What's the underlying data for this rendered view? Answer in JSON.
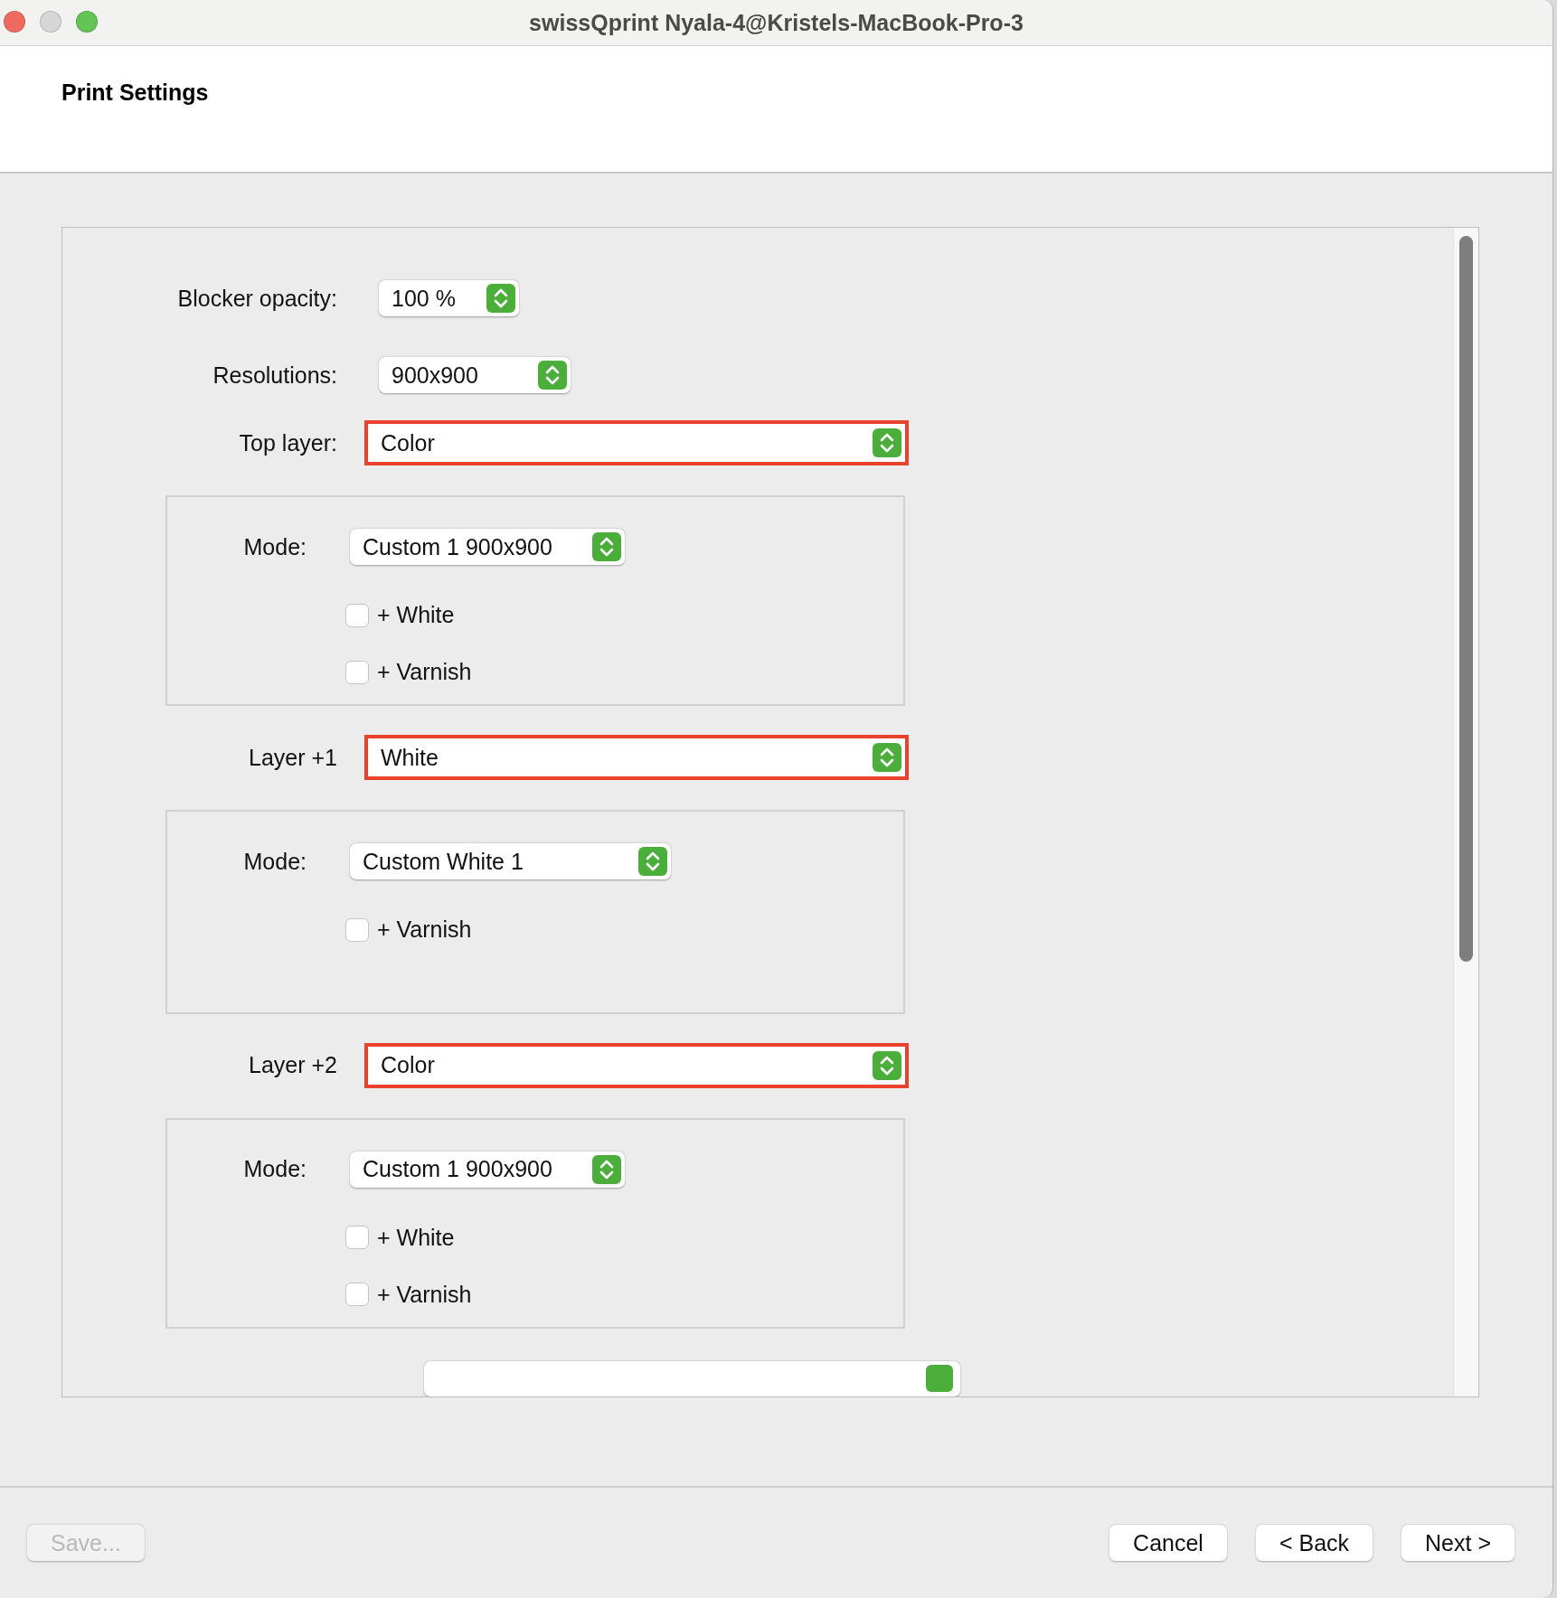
{
  "window": {
    "title": "swissQprint Nyala-4@Kristels-MacBook-Pro-3"
  },
  "header": {
    "title": "Print Settings"
  },
  "settings": [
    {
      "label": "Blocker opacity:",
      "value": "100 %",
      "kind": "small"
    },
    {
      "label": "Resolutions:",
      "value": "900x900",
      "kind": "medium"
    }
  ],
  "layers": [
    {
      "label": "Top layer:",
      "value": "Color",
      "highlighted": true,
      "mode": {
        "label": "Mode:",
        "value": "Custom 1 900x900",
        "kind": "medium"
      },
      "options": [
        {
          "label": "+ White",
          "checked": false
        },
        {
          "label": "+ Varnish",
          "checked": false
        }
      ]
    },
    {
      "label": "Layer +1",
      "value": "White",
      "highlighted": true,
      "mode": {
        "label": "Mode:",
        "value": "Custom White 1",
        "kind": "wide"
      },
      "options": [
        {
          "label": "+ Varnish",
          "checked": false
        }
      ]
    },
    {
      "label": "Layer +2",
      "value": "Color",
      "highlighted": true,
      "mode": {
        "label": "Mode:",
        "value": "Custom 1 900x900",
        "kind": "medium"
      },
      "options": [
        {
          "label": "+ White",
          "checked": false
        },
        {
          "label": "+ Varnish",
          "checked": false
        }
      ]
    }
  ],
  "footer": {
    "buttons": [
      {
        "label": "Save...",
        "disabled": true,
        "kind": "left"
      },
      {
        "label": "Cancel",
        "disabled": false,
        "kind": "right"
      },
      {
        "label": "< Back",
        "disabled": false,
        "kind": "right"
      },
      {
        "label": "Next >",
        "disabled": false,
        "kind": "right"
      }
    ]
  }
}
